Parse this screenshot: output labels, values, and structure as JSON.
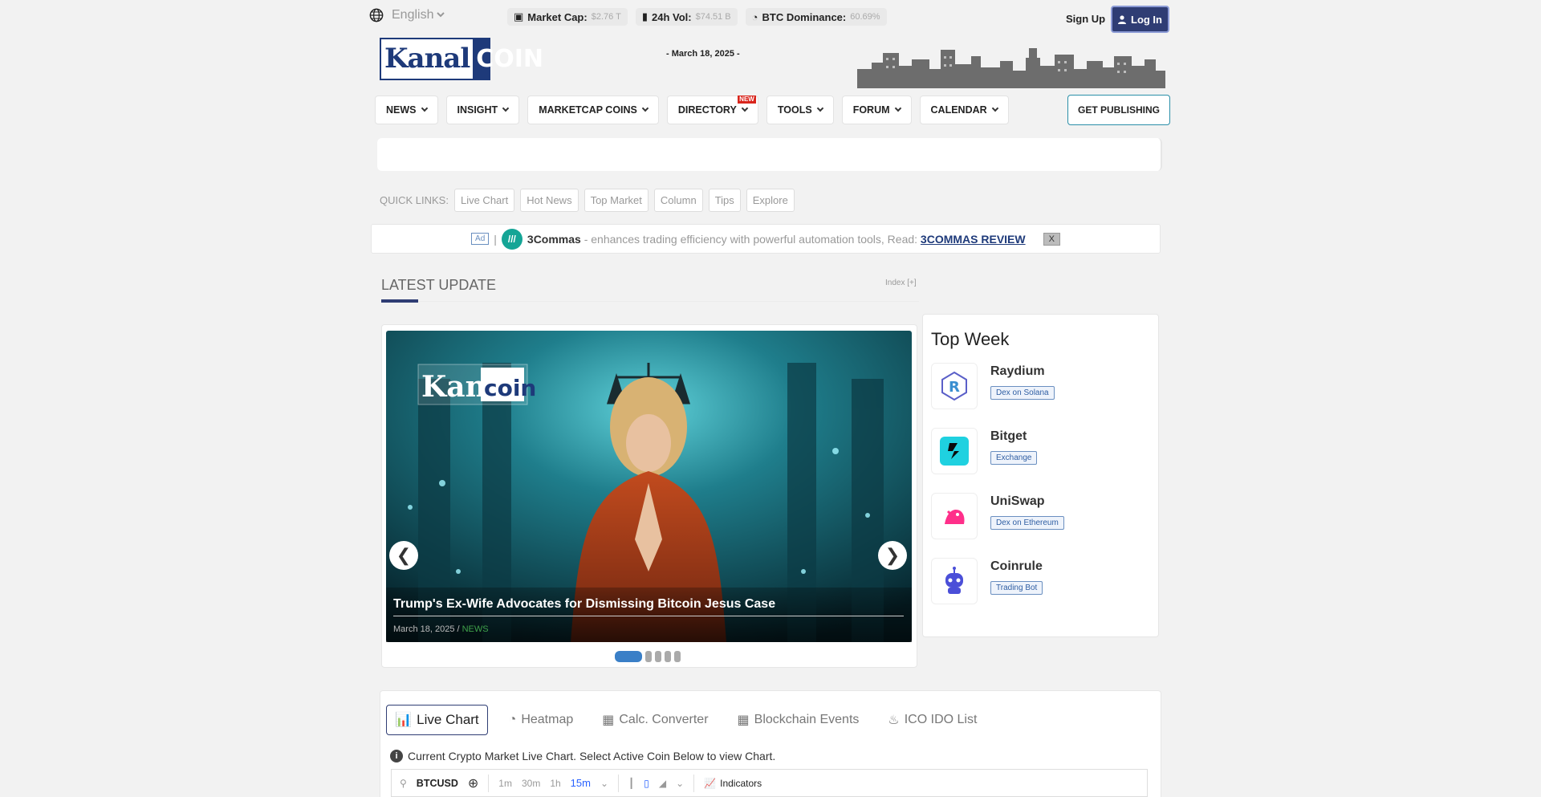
{
  "topbar": {
    "language": "English",
    "stats": [
      {
        "label": "Market Cap:",
        "value": "$2.76 T"
      },
      {
        "label": "24h Vol:",
        "value": "$74.51 B"
      },
      {
        "label": "BTC Dominance:",
        "value": "60.69%"
      }
    ],
    "signup": "Sign Up",
    "login": "Log In"
  },
  "header": {
    "logo_left": "Kanal",
    "logo_right": "COIN",
    "date": "- March 18, 2025 -"
  },
  "nav": {
    "items": [
      "NEWS",
      "INSIGHT",
      "MARKETCAP COINS",
      "DIRECTORY",
      "TOOLS",
      "FORUM",
      "CALENDAR"
    ],
    "new_badge": "NEW",
    "publish": "GET PUBLISHING"
  },
  "quick_links": {
    "label": "QUICK LINKS:",
    "items": [
      "Live Chart",
      "Hot News",
      "Top Market",
      "Column",
      "Tips",
      "Explore"
    ]
  },
  "ad": {
    "tag": "Ad",
    "brand": "3Commas",
    "text": " - enhances trading efficiency with powerful automation tools, Read: ",
    "link": "3COMMAS REVIEW",
    "close": "X"
  },
  "latest": {
    "title": "LATEST UPDATE",
    "index": "Index [+]",
    "slide": {
      "title": "Trump's Ex-Wife Advocates for Dismissing Bitcoin Jesus Case",
      "date": "March 18, 2025 / ",
      "category": "NEWS",
      "dots": 5,
      "active_dot": 1
    }
  },
  "top_week": {
    "title": "Top Week",
    "items": [
      {
        "name": "Raydium",
        "tag": "Dex on Solana",
        "icon": "raydium-icon"
      },
      {
        "name": "Bitget",
        "tag": "Exchange",
        "icon": "bitget-icon"
      },
      {
        "name": "UniSwap",
        "tag": "Dex on Ethereum",
        "icon": "uniswap-icon"
      },
      {
        "name": "Coinrule",
        "tag": "Trading Bot",
        "icon": "coinrule-icon"
      }
    ]
  },
  "live": {
    "tabs": [
      "Live Chart",
      "Heatmap",
      "Calc. Converter",
      "Blockchain Events",
      "ICO IDO List"
    ],
    "info": "Current Crypto Market Live Chart. Select Active Coin Below to view Chart.",
    "symbol": "BTCUSD",
    "timeframes": [
      "1m",
      "30m",
      "1h",
      "15m"
    ],
    "indicators": "Indicators"
  }
}
